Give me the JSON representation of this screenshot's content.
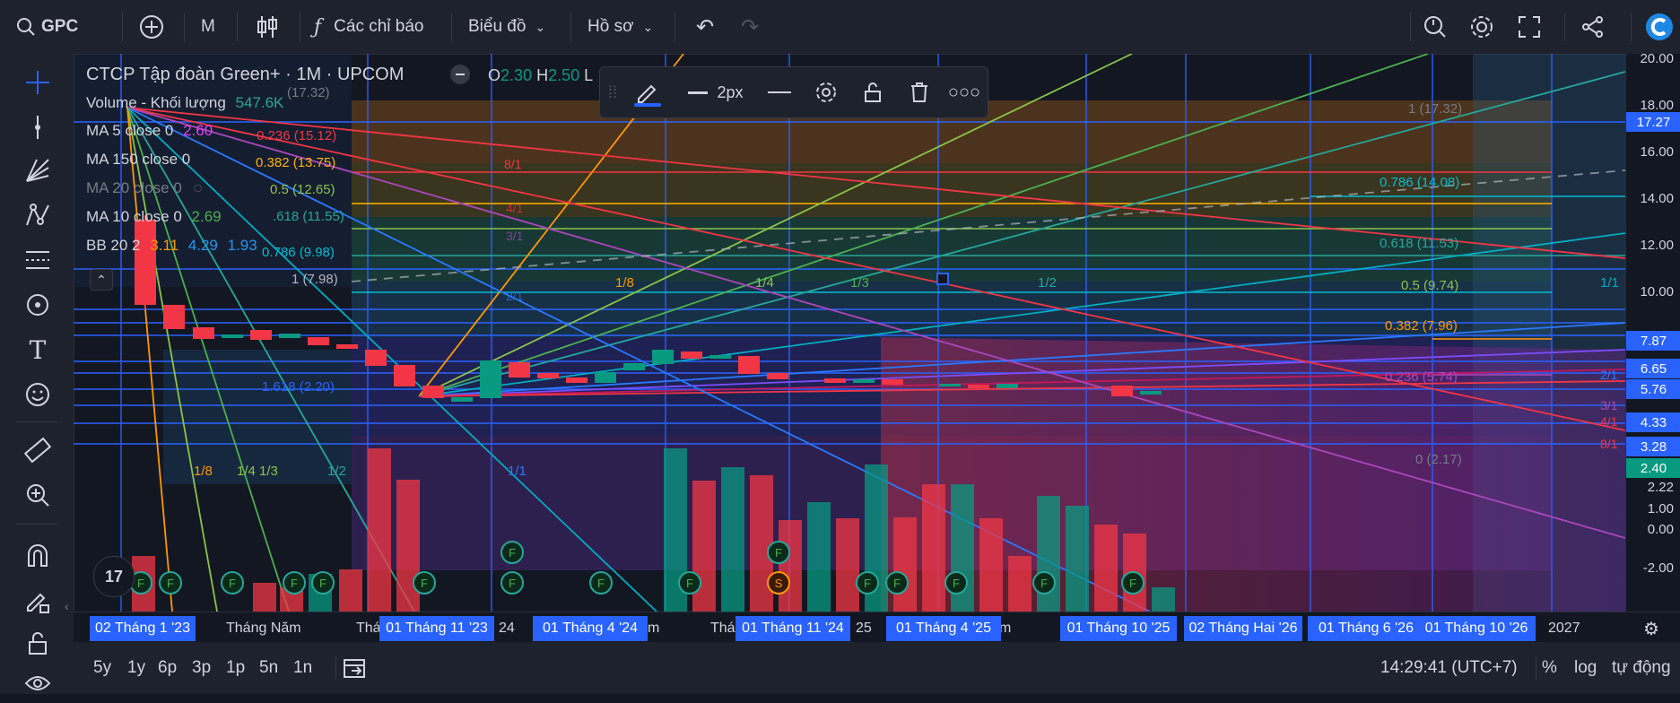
{
  "toolbar": {
    "symbol": "GPC",
    "interval": "M",
    "indicators_label": "Các chỉ báo",
    "chart_label": "Biểu đồ",
    "profile_label": "Hồ sơ"
  },
  "legend": {
    "title": "CTCP Tập đoàn Green+ · 1M · UPCOM",
    "ohlc_o_label": "O",
    "ohlc_o": "2.30",
    "ohlc_h_label": "H",
    "ohlc_h": "2.50",
    "ohlc_l_label": "L",
    "volume_label": "Volume - Khối lượng",
    "volume_value": "547.6K",
    "ma5_label": "MA 5 close 0",
    "ma5_value": "2.60",
    "ma150_label": "MA 150 close 0",
    "ma20_label": "MA 20 close 0",
    "ma10_label": "MA 10 close 0",
    "ma10_value": "2.69",
    "bb_label": "BB 20 2",
    "bb_v1": "3.11",
    "bb_v2": "4.29",
    "bb_v3": "1.93"
  },
  "drawing_toolbar": {
    "width_label": "2px"
  },
  "fib_left": [
    {
      "text": "(17.32)"
    },
    {
      "text": "0.236 (15.12)"
    },
    {
      "text": "0.382 (13.75)"
    },
    {
      "text": "0.5 (12.65)"
    },
    {
      "text": ".618 (11.55)"
    },
    {
      "text": "0.786 (9.98)"
    },
    {
      "text": "1 (7.98)"
    },
    {
      "text": "1.618 (2.20)"
    }
  ],
  "fib_right": [
    {
      "text": "1 (17.32)"
    },
    {
      "text": "0.786 (14.08)"
    },
    {
      "text": "0.618 (11.53)"
    },
    {
      "text": "0.5 (9.74)"
    },
    {
      "text": "0.382 (7.96)"
    },
    {
      "text": "0.236 (5.74)"
    },
    {
      "text": "0 (2.17)"
    }
  ],
  "gann_labels": [
    "8/1",
    "4/1",
    "3/1",
    "2/1",
    "1/8",
    "1/4",
    "1/3",
    "1/2",
    "1/1",
    "1/8",
    "1/4 1/3",
    "1/2",
    "1/1",
    "2/1",
    "3/1",
    "4/1",
    "8/1"
  ],
  "price_axis": {
    "labels": [
      "20.00",
      "18.00",
      "16.00",
      "14.00",
      "12.00",
      "10.00",
      "2.22",
      "1.00",
      "0.00",
      "-2.00"
    ],
    "badges": [
      {
        "text": "17.27",
        "color": "#2962ff"
      },
      {
        "text": "7.87",
        "color": "#2962ff"
      },
      {
        "text": "6.65",
        "color": "#2962ff"
      },
      {
        "text": "5.76",
        "color": "#2962ff"
      },
      {
        "text": "4.33",
        "color": "#2962ff"
      },
      {
        "text": "3.28",
        "color": "#2962ff"
      },
      {
        "text": "2.40",
        "color": "#089981"
      }
    ]
  },
  "time_axis": {
    "badges": [
      "02 Tháng 1 '23",
      "01 Tháng 11 '23",
      "01 Tháng 4 '24",
      "01 Tháng 11 '24",
      "01 Tháng 4 '25",
      "01 Tháng 10 '25",
      "02 Tháng Hai '26",
      "01 Tháng 6 '26",
      "01 Tháng 10 '26"
    ],
    "labels": [
      "Tháng Năm",
      "Thá",
      "24",
      "m",
      "Thá",
      "25",
      "m",
      "2027"
    ]
  },
  "bottom": {
    "ranges": [
      "5y",
      "1y",
      "6p",
      "3p",
      "1p",
      "5n",
      "1n"
    ],
    "time": "14:29:41 (UTC+7)",
    "percent": "%",
    "log": "log",
    "auto": "tự động"
  },
  "markers": {
    "f": "F",
    "s": "S"
  },
  "colors": {
    "accent": "#2962ff",
    "up": "#089981",
    "down": "#f23645",
    "bg": "#131722"
  }
}
